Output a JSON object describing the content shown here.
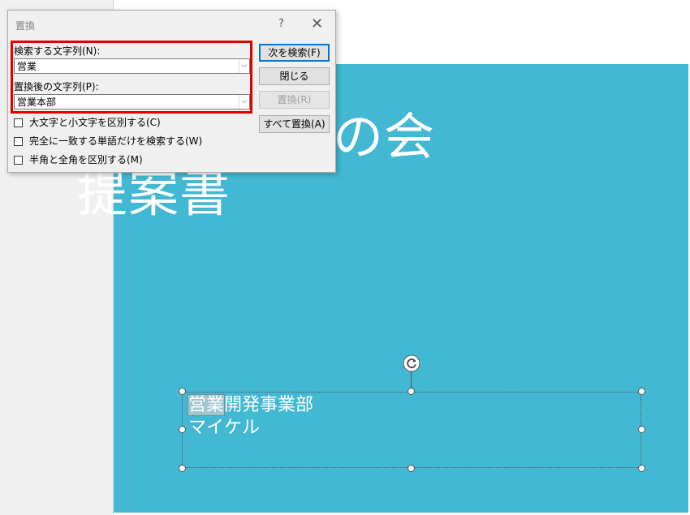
{
  "dialog": {
    "title": "置換",
    "help": "?",
    "close": "✕",
    "find_label": "検索する文字列(N):",
    "find_value": "営業",
    "replace_label": "置換後の文字列(P):",
    "replace_value": "営業本部",
    "buttons": {
      "find_next": "次を検索(F)",
      "close": "閉じる",
      "replace": "置換(R)",
      "replace_all": "すべて置換(A)"
    },
    "options": [
      "大文字と小文字を区別する(C)",
      "完全に一致する単語だけを検索する(W)",
      "半角と全角を区別する(M)"
    ]
  },
  "slide": {
    "title_line1": "全社お花見の会",
    "title_line2": "提案書",
    "subtitle_highlight": "営業",
    "subtitle_rest": "開発事業部",
    "subtitle_line2": "マイケル"
  },
  "colors": {
    "slide_bg": "#42b8d3",
    "highlight_box": "#e00000"
  }
}
